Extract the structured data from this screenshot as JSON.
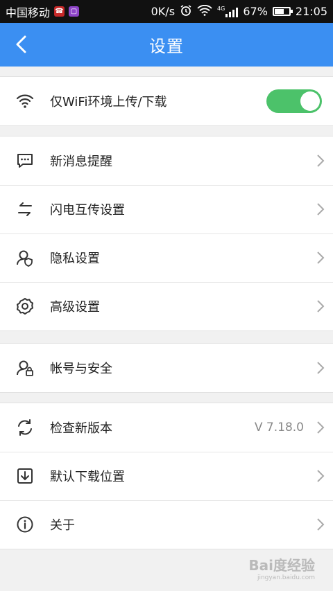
{
  "status_bar": {
    "carrier": "中国移动",
    "network_speed": "0K/s",
    "network_type": "4G",
    "battery": "67%",
    "battery_level": 0.67,
    "time": "21:05"
  },
  "app_bar": {
    "title": "设置"
  },
  "groups": [
    {
      "items": [
        {
          "icon": "wifi-icon",
          "label": "仅WiFi环境上传/下载",
          "control": "toggle",
          "toggle_on": true
        }
      ]
    },
    {
      "items": [
        {
          "icon": "message-icon",
          "label": "新消息提醒"
        },
        {
          "icon": "transfer-icon",
          "label": "闪电互传设置"
        },
        {
          "icon": "privacy-icon",
          "label": "隐私设置"
        },
        {
          "icon": "gear-icon",
          "label": "高级设置"
        }
      ]
    },
    {
      "items": [
        {
          "icon": "account-lock-icon",
          "label": "帐号与安全"
        }
      ]
    },
    {
      "items": [
        {
          "icon": "refresh-icon",
          "label": "检查新版本",
          "value": "V 7.18.0"
        },
        {
          "icon": "download-icon",
          "label": "默认下载位置"
        },
        {
          "icon": "info-icon",
          "label": "关于"
        }
      ]
    }
  ],
  "watermark": {
    "text": "Bai度经验",
    "sub": "jingyan.baidu.com"
  },
  "colors": {
    "app_bar": "#3b8ff2",
    "toggle_on": "#4cc26a",
    "background": "#f1f1f1"
  }
}
